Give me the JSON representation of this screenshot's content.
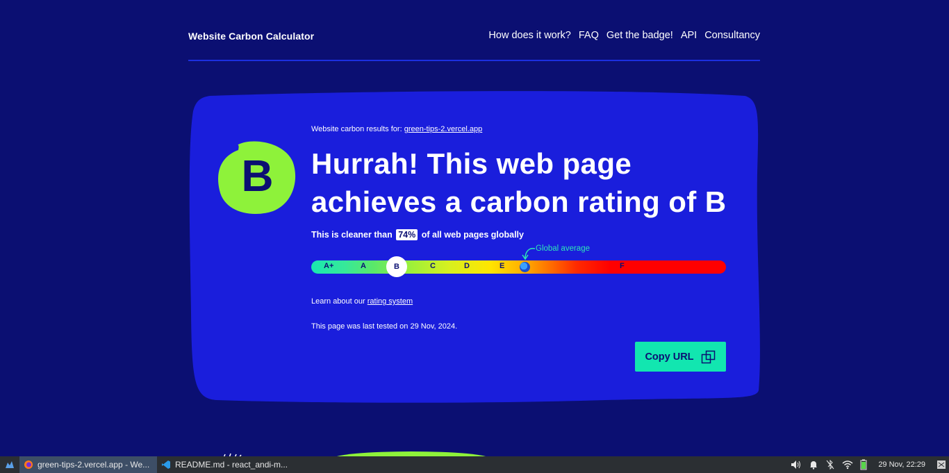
{
  "header": {
    "brand": "Website Carbon Calculator",
    "nav": [
      "How does it work?",
      "FAQ",
      "Get the badge!",
      "API",
      "Consultancy"
    ]
  },
  "result": {
    "results_for_label": "Website carbon results for:",
    "site": "green-tips-2.vercel.app",
    "grade": "B",
    "headline": "Hurrah! This web page achieves a carbon rating of B",
    "cleaner_prefix": "This is cleaner than",
    "cleaner_percent": "74%",
    "cleaner_suffix": "of all web pages globally",
    "scale_labels": [
      "A+",
      "A",
      "B",
      "C",
      "D",
      "E",
      "F"
    ],
    "current_grade": "B",
    "global_average_label": "Global average",
    "learn_prefix": "Learn about our",
    "learn_link": "rating system",
    "last_tested": "This page was last tested on 29 Nov, 2024.",
    "copy_button": "Copy URL"
  },
  "colors": {
    "background": "#0b0f72",
    "card": "#1a1edc",
    "accent_green": "#8ef23a",
    "accent_teal": "#12e6b0"
  },
  "taskbar": {
    "tasks": [
      {
        "label": "green-tips-2.vercel.app - We...",
        "icon": "firefox-icon",
        "active": true
      },
      {
        "label": "README.md - react_andi-m...",
        "icon": "vscode-icon",
        "active": false
      }
    ],
    "clock": "29 Nov, 22:29"
  }
}
